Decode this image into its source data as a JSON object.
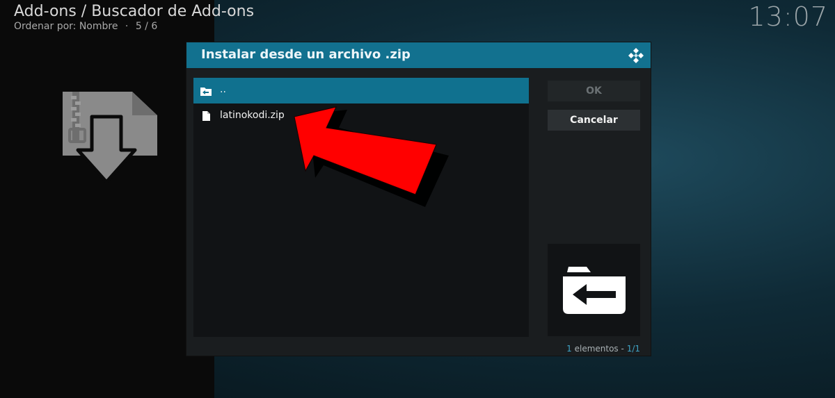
{
  "header": {
    "title": "Add-ons / Buscador de Add-ons",
    "sort_label": "Ordenar por: Nombre",
    "separator": "·",
    "position": "5 / 6"
  },
  "clock": "13:07",
  "left_icon": "zip-install-icon",
  "dialog": {
    "title": "Instalar desde un archivo .zip",
    "logo_icon": "kodi-logo-icon",
    "items": [
      {
        "label": "..",
        "icon": "folder-back-icon",
        "selected": true
      },
      {
        "label": "latinokodi.zip",
        "icon": "file-icon",
        "selected": false
      }
    ],
    "ok_label": "OK",
    "cancel_label": "Cancelar",
    "preview_icon": "folder-back-large-icon",
    "footer": {
      "count": "1",
      "count_word": "elementos",
      "dash": "-",
      "page": "1/1"
    }
  },
  "colors": {
    "accent": "#12718f",
    "highlight_text": "#3fa5c7",
    "arrow": "#ff0000"
  }
}
